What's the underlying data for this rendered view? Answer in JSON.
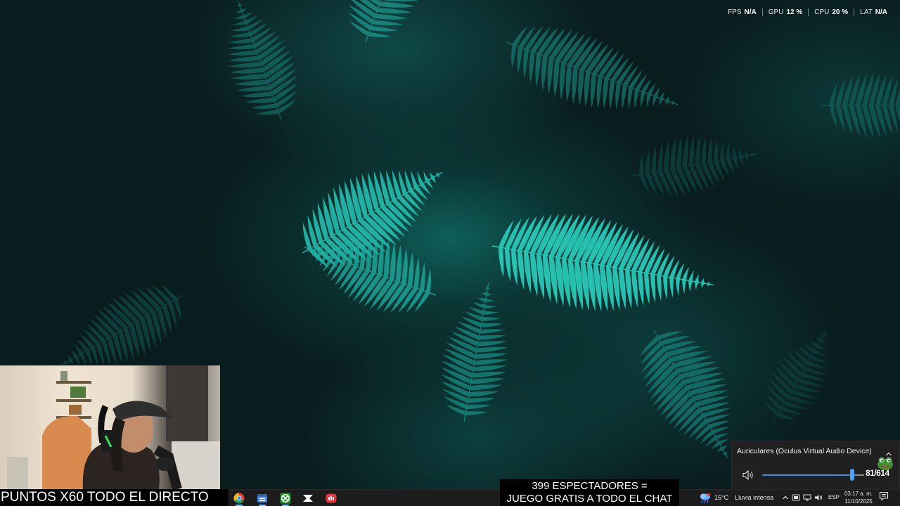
{
  "perf_overlay": {
    "items": [
      {
        "label": "FPS",
        "value": "N/A"
      },
      {
        "label": "GPU",
        "value": "12 %"
      },
      {
        "label": "CPU",
        "value": "20 %"
      },
      {
        "label": "LAT",
        "value": "N/A"
      }
    ]
  },
  "stream_overlay": {
    "left_text": "PUNTOS X60 TODO EL DIRECTO",
    "banner_line1": "399 ESPECTADORES =",
    "banner_line2": "JUEGO GRATIS A TODO EL CHAT"
  },
  "taskbar": {
    "apps": [
      {
        "name": "chrome",
        "icon": "chrome-icon",
        "active": true
      },
      {
        "name": "app-window",
        "icon": "window-app-icon",
        "active": true
      },
      {
        "name": "xbox",
        "icon": "xbox-icon",
        "active": true
      },
      {
        "name": "capcut",
        "icon": "capcut-icon",
        "active": false
      },
      {
        "name": "streamlabs",
        "icon": "streamlabs-icon",
        "active": false
      }
    ]
  },
  "tray": {
    "weather_temp": "15°C",
    "weather_desc": "Lluvia intensa",
    "language": "ESP",
    "time": "03:17 a. m.",
    "date": "11/10/2025"
  },
  "volume_flyout": {
    "device": "Auriculares (Oculus Virtual Audio Device)",
    "volume_level": 85,
    "volume_text": "81/614"
  },
  "colors": {
    "taskbar_bg": "#1c1c1c",
    "accent": "#4ea1ff",
    "fern": "#1fb5a6"
  }
}
